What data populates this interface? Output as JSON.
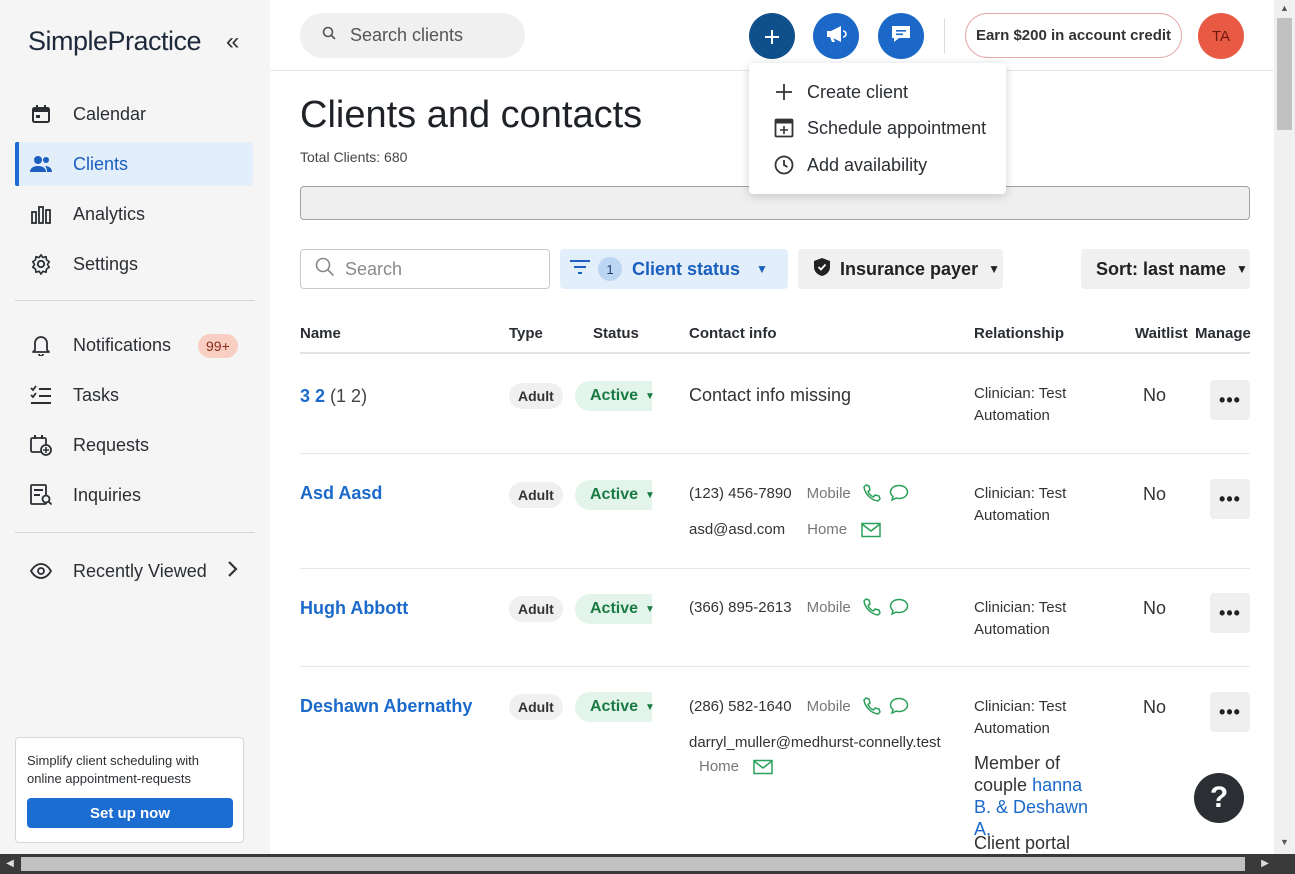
{
  "brand": {
    "logo_text": "SimplePractice",
    "collapse_glyph": "«"
  },
  "sidebar": {
    "items": [
      {
        "label": "Calendar",
        "icon": "calendar-icon"
      },
      {
        "label": "Clients",
        "icon": "clients-icon",
        "active": true
      },
      {
        "label": "Analytics",
        "icon": "analytics-icon"
      },
      {
        "label": "Settings",
        "icon": "gear-icon"
      },
      {
        "label": "Notifications",
        "icon": "bell-icon",
        "badge": "99+"
      },
      {
        "label": "Tasks",
        "icon": "tasks-icon"
      },
      {
        "label": "Requests",
        "icon": "requests-icon"
      },
      {
        "label": "Inquiries",
        "icon": "inquiries-icon"
      },
      {
        "label": "Recently Viewed",
        "icon": "eye-icon"
      }
    ],
    "promo": {
      "text": "Simplify client scheduling with online appointment-requests",
      "button": "Set up now"
    }
  },
  "topbar": {
    "search_placeholder": "Search clients",
    "earn_label": "Earn $200 in account credit",
    "avatar_initials": "TA"
  },
  "dropdown": {
    "items": [
      {
        "label": "Create client",
        "icon": "plus-icon"
      },
      {
        "label": "Schedule appointment",
        "icon": "calendar-plus-icon"
      },
      {
        "label": "Add availability",
        "icon": "clock-icon"
      }
    ]
  },
  "main": {
    "title": "Clients and contacts",
    "total": "Total Clients: 680",
    "filters": {
      "search_placeholder": "Search",
      "status_count": "1",
      "status_label": "Client status",
      "insurance_label": "Insurance payer",
      "sort_label": "Sort: last name"
    },
    "columns": [
      "Name",
      "Type",
      "Status",
      "Contact info",
      "Relationship",
      "Waitlist",
      "Manage"
    ],
    "rows": [
      {
        "name": "3 2",
        "name_sub": "(1 2)",
        "type": "Adult",
        "status": "Active",
        "contact_missing": "Contact info missing",
        "relationship": "Clinician: Test Automation",
        "waitlist": "No",
        "manage": "•••"
      },
      {
        "name": "Asd Aasd",
        "type": "Adult",
        "status": "Active",
        "phone": "(123) 456-7890",
        "phone_kind": "Mobile",
        "email": "asd@asd.com",
        "email_kind": "Home",
        "relationship": "Clinician: Test Automation",
        "waitlist": "No",
        "manage": "•••"
      },
      {
        "name": "Hugh Abbott",
        "type": "Adult",
        "status": "Active",
        "phone": "(366) 895-2613",
        "phone_kind": "Mobile",
        "relationship": "Clinician: Test Automation",
        "waitlist": "No",
        "manage": "•••"
      },
      {
        "name": "Deshawn Abernathy",
        "type": "Adult",
        "status": "Active",
        "phone": "(286) 582-1640",
        "phone_kind": "Mobile",
        "email": "darryl_muller@medhurst-connelly.test",
        "email_kind": "Home",
        "relationship": "Clinician: Test Automation",
        "member_of": "Member of couple",
        "couple_link": "hanna B. & Deshawn A.",
        "portal": "Client portal",
        "waitlist": "No",
        "manage": "•••"
      }
    ]
  },
  "help_glyph": "?",
  "colors": {
    "accent": "#1b6acb",
    "active_bg": "#e2eefa",
    "status_green": "#1a7a44",
    "badge_bg": "#f9cfc4",
    "avatar_bg": "#e95a45"
  }
}
